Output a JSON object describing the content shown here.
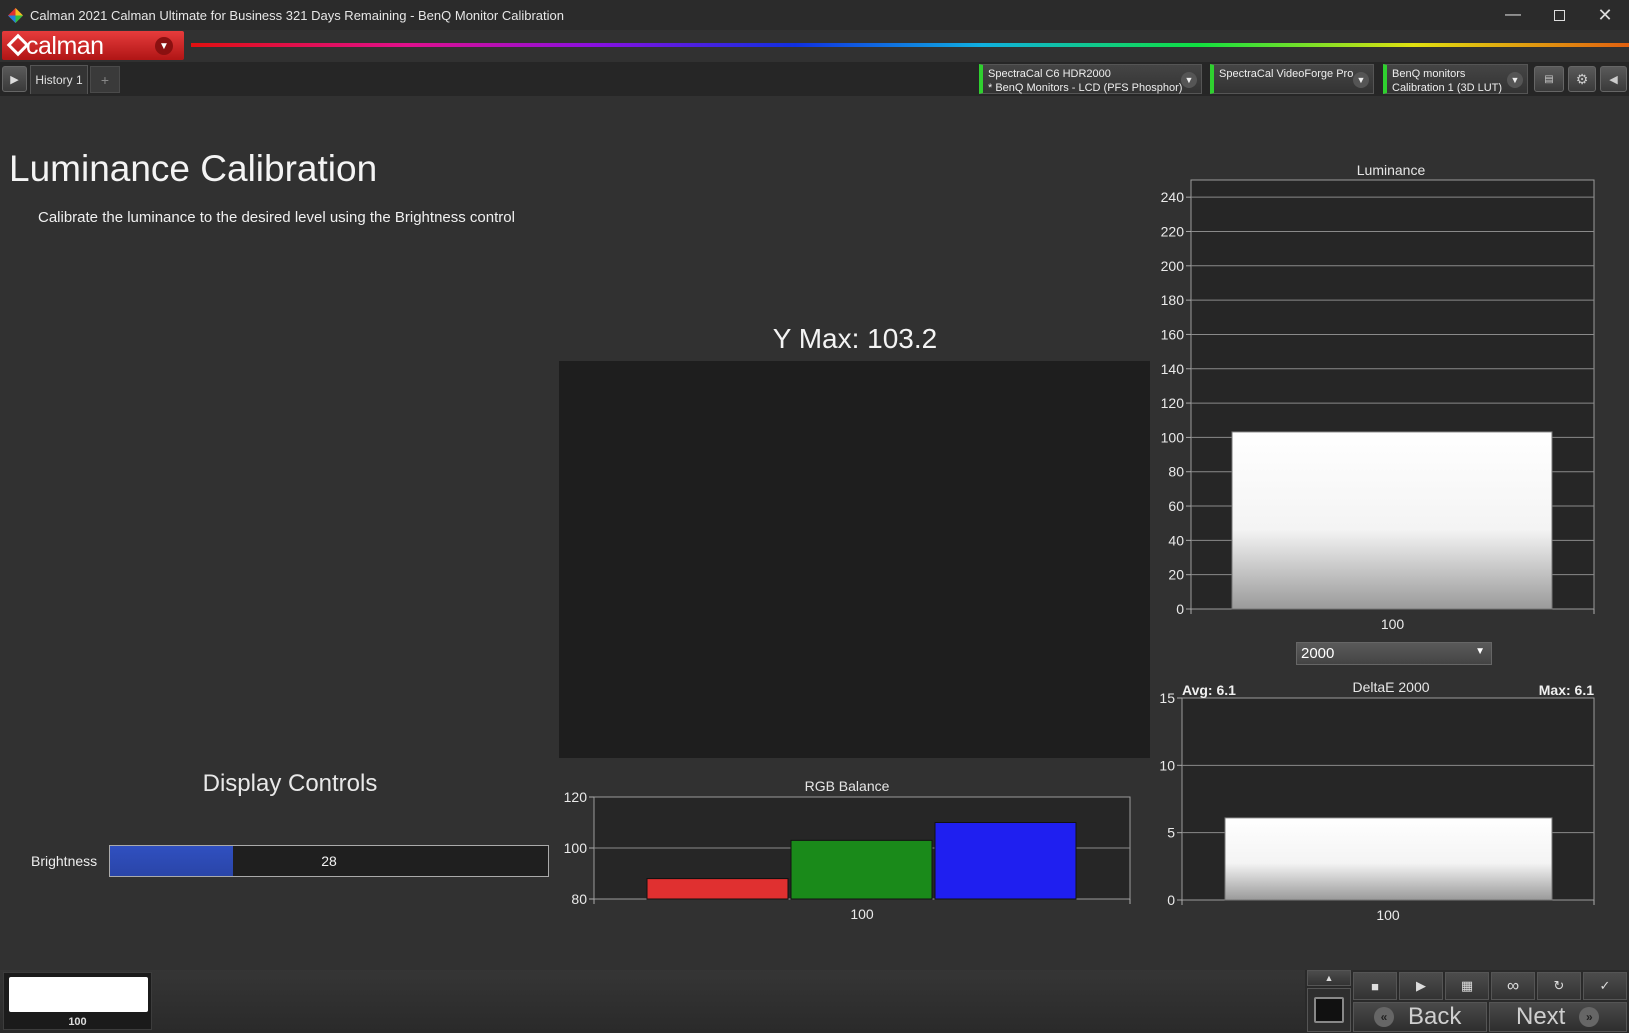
{
  "window": {
    "title": "Calman 2021 Calman Ultimate for Business 321 Days Remaining  -  BenQ Monitor Calibration",
    "minimize_icon": "minimize-icon",
    "maximize_icon": "maximize-icon",
    "close_icon": "close-icon"
  },
  "logo": {
    "text": "calman"
  },
  "tabs": {
    "items": [
      {
        "label": "History 1"
      }
    ],
    "add_label": "+"
  },
  "devices": [
    {
      "line1": "SpectraCal C6 HDR2000",
      "line2": "* BenQ Monitors - LCD (PFS Phosphor)"
    },
    {
      "line1": "SpectraCal VideoForge Pro",
      "line2": ""
    },
    {
      "line1": "BenQ monitors",
      "line2": "Calibration 1 (3D LUT)"
    }
  ],
  "page": {
    "title": "Luminance Calibration",
    "description": "Calibrate the luminance to the desired level using the Brightness control",
    "ymax": "Y Max: 103.2"
  },
  "display_controls": {
    "title": "Display Controls",
    "brightness_label": "Brightness",
    "brightness_value": "28",
    "brightness_fraction": 0.28
  },
  "deltae_select": {
    "value": "2000"
  },
  "chart_data": [
    {
      "type": "bar",
      "title": "Luminance",
      "categories": [
        "100"
      ],
      "values": [
        103.2
      ],
      "ylim": [
        0,
        250
      ],
      "yticks": [
        0,
        20,
        40,
        60,
        80,
        100,
        120,
        140,
        160,
        180,
        200,
        220,
        240
      ],
      "grid": true,
      "bar_colors": [
        "#ffffff"
      ]
    },
    {
      "type": "bar",
      "title": "RGB Balance",
      "categories": [
        "100"
      ],
      "series": [
        {
          "values": [
            88
          ],
          "color": "#e03030"
        },
        {
          "values": [
            103
          ],
          "color": "#1a8a1a"
        },
        {
          "values": [
            110
          ],
          "color": "#1f1ff0"
        }
      ],
      "ylim": [
        80,
        120
      ],
      "yticks": [
        80,
        100,
        120
      ],
      "grid": true
    },
    {
      "type": "bar",
      "title": "DeltaE 2000",
      "categories": [
        "100"
      ],
      "values": [
        6.1
      ],
      "ylim": [
        0,
        15
      ],
      "yticks": [
        0,
        5,
        10,
        15
      ],
      "grid": true,
      "avg_label": "Avg: 6.1",
      "max_label": "Max: 6.1",
      "bar_colors": [
        "#ffffff"
      ]
    }
  ],
  "bottom": {
    "thumb_label": "100",
    "back_label": "Back",
    "next_label": "Next"
  }
}
